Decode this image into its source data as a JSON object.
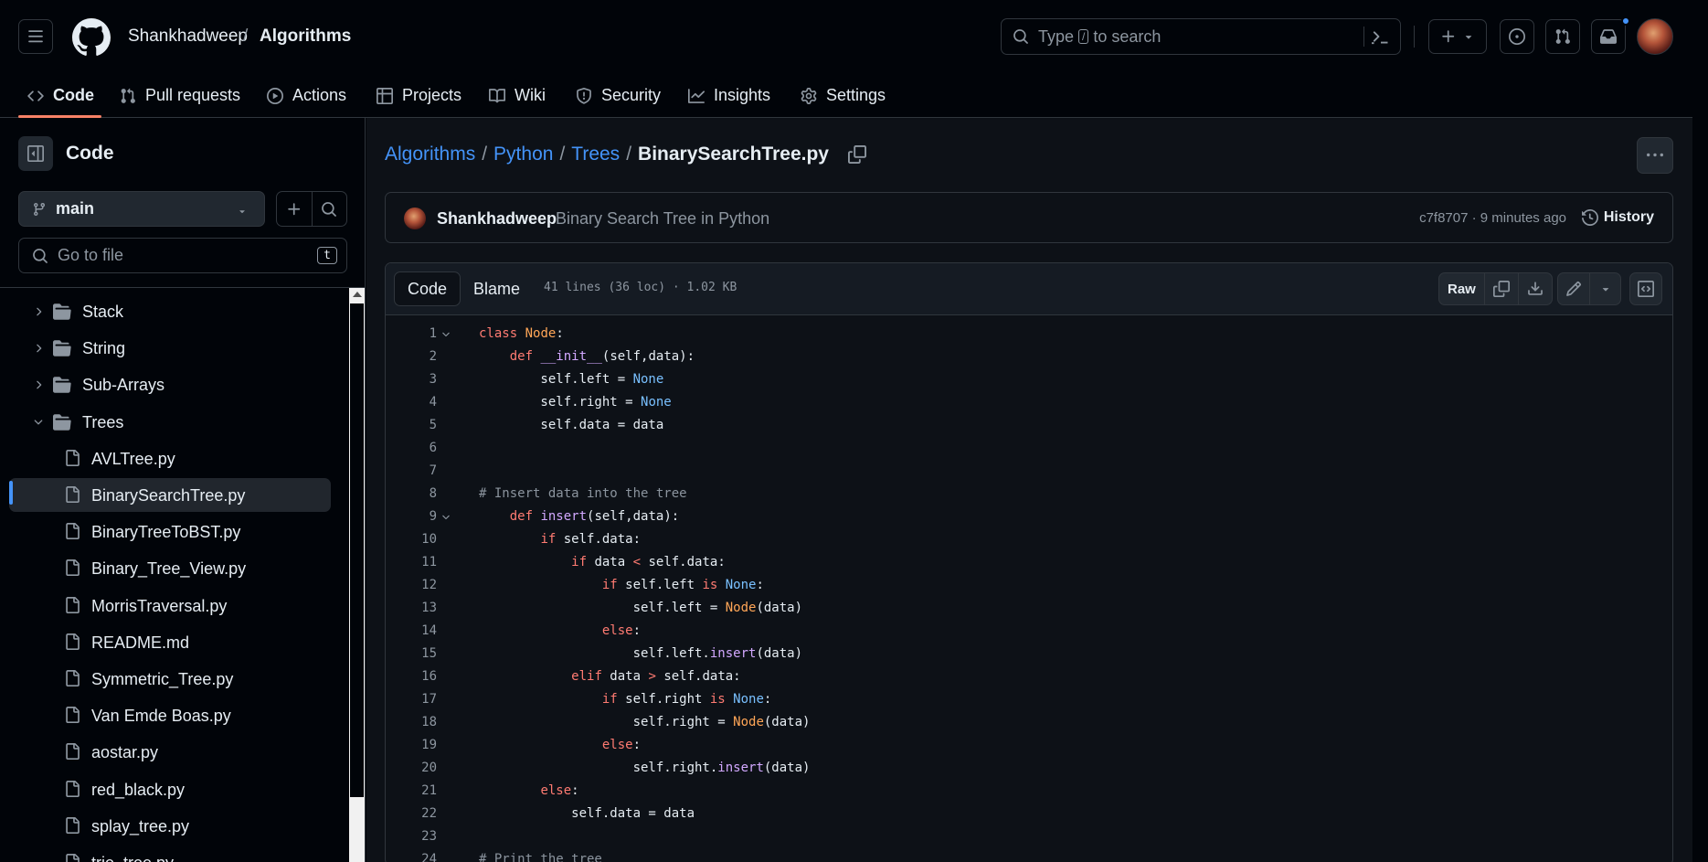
{
  "header": {
    "owner": "Shankhadweep",
    "sep": "/",
    "repo": "Algorithms",
    "search_pre": "Type",
    "search_key": "/",
    "search_post": "to search"
  },
  "tabs": [
    {
      "label": "Code",
      "icon": "code-icon"
    },
    {
      "label": "Pull requests",
      "icon": "git-pull-request-icon"
    },
    {
      "label": "Actions",
      "icon": "play-icon"
    },
    {
      "label": "Projects",
      "icon": "table-icon"
    },
    {
      "label": "Wiki",
      "icon": "book-icon"
    },
    {
      "label": "Security",
      "icon": "shield-icon"
    },
    {
      "label": "Insights",
      "icon": "graph-icon"
    },
    {
      "label": "Settings",
      "icon": "gear-icon"
    }
  ],
  "sidebar": {
    "title": "Code",
    "branch": "main",
    "go_to_file": "Go to file",
    "go_to_file_key": "t",
    "tree": [
      {
        "label": "Stack",
        "type": "folder",
        "expanded": false
      },
      {
        "label": "String",
        "type": "folder",
        "expanded": false
      },
      {
        "label": "Sub-Arrays",
        "type": "folder",
        "expanded": false
      },
      {
        "label": "Trees",
        "type": "folder",
        "expanded": true
      },
      {
        "label": "AVLTree.py",
        "type": "file"
      },
      {
        "label": "BinarySearchTree.py",
        "type": "file",
        "selected": true
      },
      {
        "label": "BinaryTreeToBST.py",
        "type": "file"
      },
      {
        "label": "Binary_Tree_View.py",
        "type": "file"
      },
      {
        "label": "MorrisTraversal.py",
        "type": "file"
      },
      {
        "label": "README.md",
        "type": "file"
      },
      {
        "label": "Symmetric_Tree.py",
        "type": "file"
      },
      {
        "label": "Van Emde Boas.py",
        "type": "file"
      },
      {
        "label": "aostar.py",
        "type": "file"
      },
      {
        "label": "red_black.py",
        "type": "file"
      },
      {
        "label": "splay_tree.py",
        "type": "file"
      },
      {
        "label": "trie_tree.py",
        "type": "file"
      }
    ]
  },
  "breadcrumb": {
    "parts": [
      "Algorithms",
      "Python",
      "Trees"
    ],
    "sep": "/",
    "file": "BinarySearchTree.py"
  },
  "commit": {
    "author": "Shankhadweep",
    "message": "Binary Search Tree in Python",
    "meta": "c7f8707 · 9 minutes ago",
    "history": "History"
  },
  "file": {
    "tab_code": "Code",
    "tab_blame": "Blame",
    "info": "41 lines (36 loc) · 1.02 KB",
    "raw": "Raw"
  },
  "colors": {
    "accent": "#f78166",
    "link": "#4493f8",
    "keyword": "#ff7b72",
    "class": "#ffa657",
    "function": "#d2a8ff",
    "builtin": "#79c0ff"
  }
}
